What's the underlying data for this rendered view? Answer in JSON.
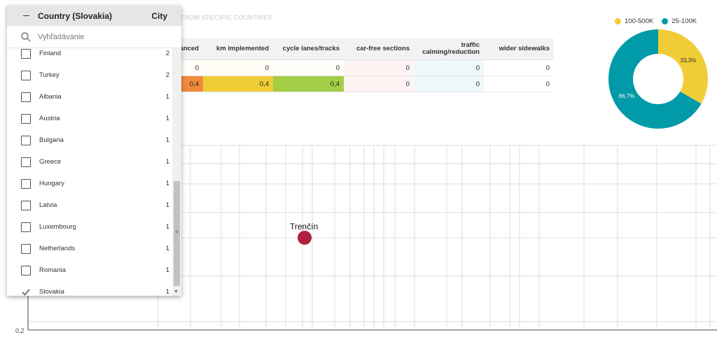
{
  "subtitle": "FROM SPECIFIC COUNTRIES",
  "table": {
    "headers": [
      "anced",
      "km implemented",
      "cycle lanes/tracks",
      "car-free sections",
      "traffic calming/reduction",
      "wider sidewalks"
    ],
    "rows": [
      [
        "0",
        "0",
        "0",
        "0",
        "0",
        "0"
      ],
      [
        "0,4",
        "0,4",
        "0,4",
        "0",
        "0",
        "0"
      ]
    ],
    "colors": {
      "orange": "#f08a3c",
      "yellow": "#f0cc36",
      "green": "#a3cd45",
      "pink": "#fdf3f3",
      "cyan": "#eef8fb",
      "cream": "#fffdf5"
    }
  },
  "plot": {
    "y_tick": "0,2",
    "point": {
      "label": "Trenčín",
      "color": "#b0203f"
    }
  },
  "donut": {
    "legend": [
      {
        "label": "100-500K",
        "color": "#f0cc36"
      },
      {
        "label": "25-100K",
        "color": "#009aa8"
      }
    ],
    "slices": [
      {
        "label": "33,3%",
        "value": 33.3,
        "color": "#f0cc36"
      },
      {
        "label": "66,7%",
        "value": 66.7,
        "color": "#009aa8"
      }
    ]
  },
  "dropdown": {
    "title": "Country (Slovakia)",
    "city_header": "City",
    "search_placeholder": "Vyhľadávanie",
    "items": [
      {
        "label": "Finland",
        "count": "2",
        "checked": false
      },
      {
        "label": "Turkey",
        "count": "2",
        "checked": false
      },
      {
        "label": "Albania",
        "count": "1",
        "checked": false
      },
      {
        "label": "Austria",
        "count": "1",
        "checked": false
      },
      {
        "label": "Bulgaria",
        "count": "1",
        "checked": false
      },
      {
        "label": "Greece",
        "count": "1",
        "checked": false
      },
      {
        "label": "Hungary",
        "count": "1",
        "checked": false
      },
      {
        "label": "Latvia",
        "count": "1",
        "checked": false
      },
      {
        "label": "Luxembourg",
        "count": "1",
        "checked": false
      },
      {
        "label": "Netherlands",
        "count": "1",
        "checked": false
      },
      {
        "label": "Romania",
        "count": "1",
        "checked": false
      },
      {
        "label": "Slovakia",
        "count": "1",
        "checked": true
      }
    ]
  }
}
